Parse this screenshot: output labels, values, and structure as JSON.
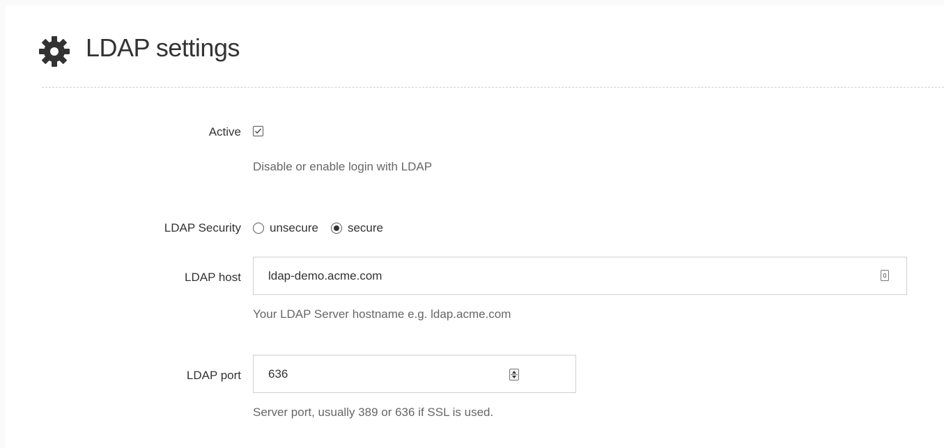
{
  "header": {
    "title": "LDAP settings",
    "icon": "gear-icon"
  },
  "form": {
    "active": {
      "label": "Active",
      "checked": true,
      "help": "Disable or enable login with LDAP"
    },
    "security": {
      "label": "LDAP Security",
      "options": [
        {
          "label": "unsecure",
          "selected": false
        },
        {
          "label": "secure",
          "selected": true
        }
      ]
    },
    "host": {
      "label": "LDAP host",
      "value": "ldap-demo.acme.com",
      "help": "Your LDAP Server hostname e.g. ldap.acme.com"
    },
    "port": {
      "label": "LDAP port",
      "value": "636",
      "help": "Server port, usually 389 or 636 if SSL is used."
    }
  }
}
